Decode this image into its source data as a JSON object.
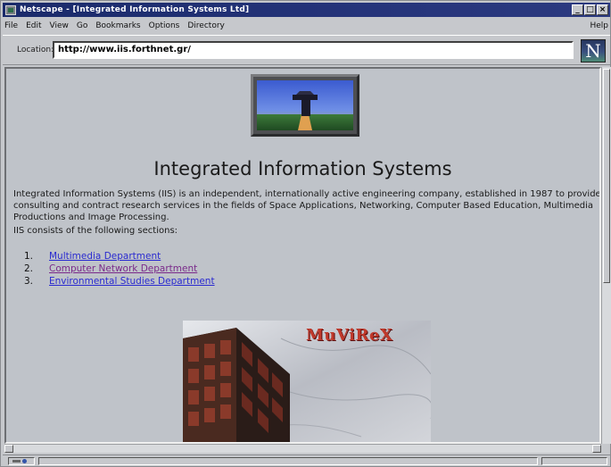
{
  "window": {
    "title": "Netscape - [Integrated Information Systems Ltd]",
    "buttons": {
      "minimize": "_",
      "maximize": "□",
      "close": "×"
    }
  },
  "menu": {
    "items": [
      "File",
      "Edit",
      "View",
      "Go",
      "Bookmarks",
      "Options",
      "Directory"
    ],
    "help": "Help"
  },
  "location": {
    "label": "Location:",
    "value": "http://www.iis.forthnet.gr/"
  },
  "brand": {
    "logo_letter": "N"
  },
  "page": {
    "heading": "Integrated Information Systems",
    "intro": "Integrated Information Systems (IIS) is an independent, internationally active engineering company, established in 1987 to provide consulting and contract research services in the fields of Space Applications, Networking, Computer Based Education, Multimedia Productions and Image Processing.",
    "sections_intro": "IIS consists of the following sections:",
    "departments": [
      {
        "num": "1.",
        "label": "Multimedia Department"
      },
      {
        "num": "2.",
        "label": "Computer Network Department"
      },
      {
        "num": "3.",
        "label": "Environmental Studies Department"
      }
    ],
    "banner_title": "MuViReX"
  },
  "icons": {
    "app": "netscape-app-icon",
    "logo": "netscape-n-logo",
    "security": "key-icon"
  }
}
